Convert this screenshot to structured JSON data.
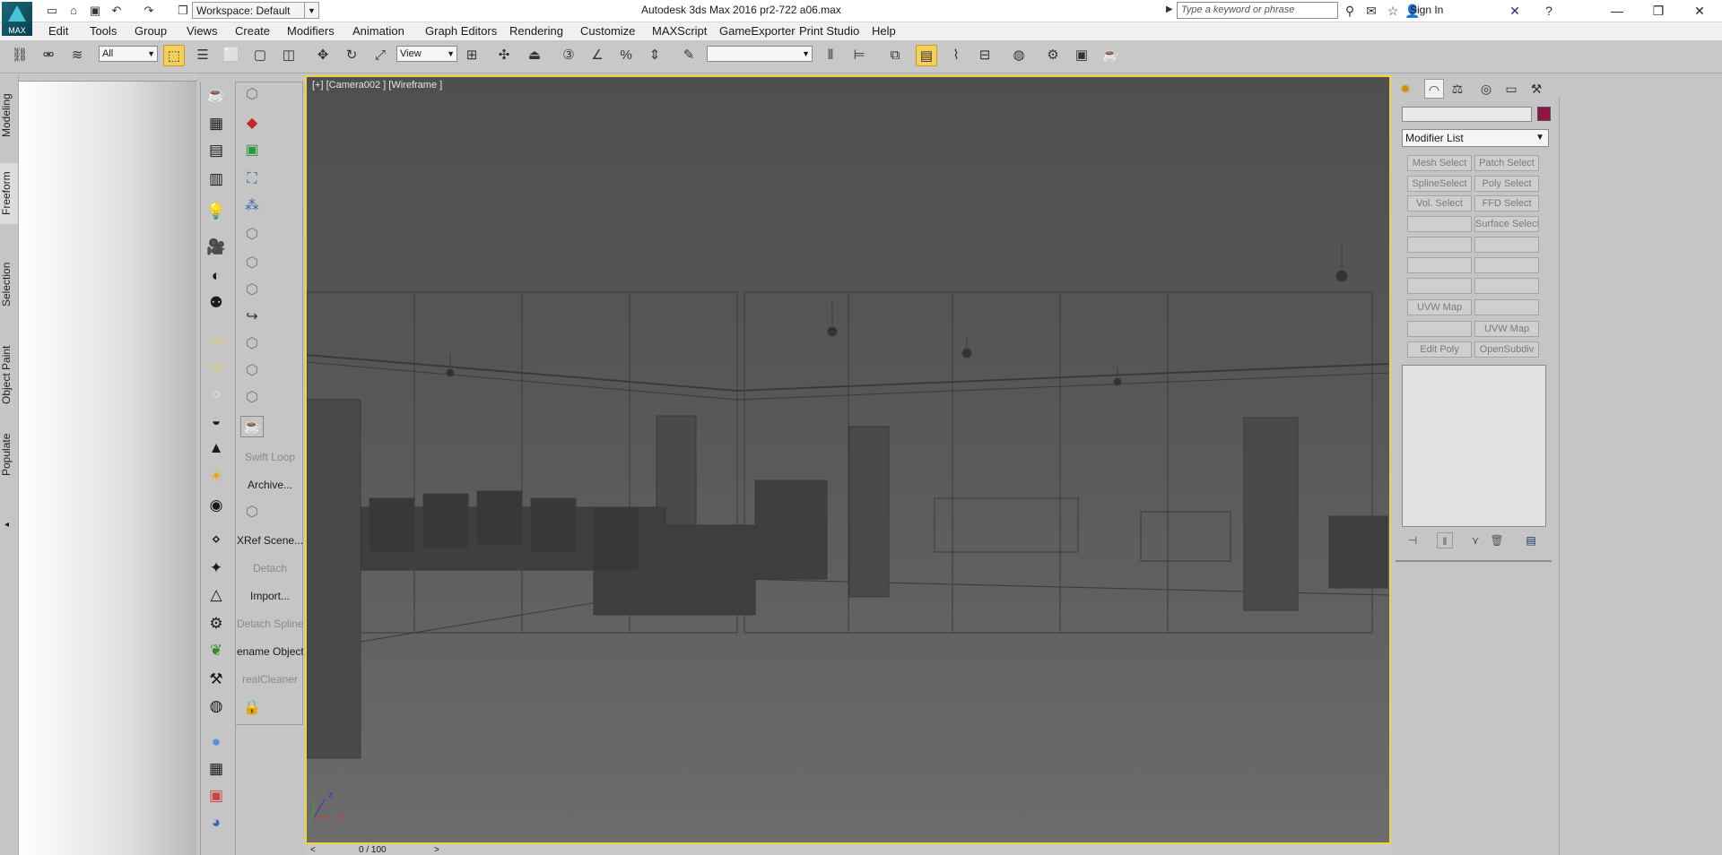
{
  "app": {
    "logo_text": "MAX",
    "window_title": "Autodesk 3ds Max 2016    pr2-722 a06.max",
    "workspace_label": "Workspace: Default",
    "search_placeholder": "Type a keyword or phrase",
    "sign_in": "Sign In"
  },
  "menu": [
    "Edit",
    "Tools",
    "Group",
    "Views",
    "Create",
    "Modifiers",
    "Animation",
    "Graph Editors",
    "Rendering",
    "Customize",
    "MAXScript",
    "GameExporter",
    "Print Studio",
    "Help"
  ],
  "toolbar": {
    "selection_filter": "All",
    "reference_coord": "View",
    "named_selection": ""
  },
  "ribbon_tabs": [
    "Modeling",
    "Freeform",
    "Selection",
    "Object Paint",
    "Populate"
  ],
  "custom_toolbar": {
    "swift_loop": "Swift Loop",
    "archive": "Archive...",
    "xref_scene": "XRef Scene...",
    "detach": "Detach",
    "import": "Import...",
    "detach_spline": "Detach Spline",
    "rename_objects": "ename Objects",
    "real_cleaner": "realCleaner"
  },
  "viewport": {
    "label": "[+] [Camera002 ] [Wireframe ]",
    "axis_x": "x",
    "axis_y": "y",
    "axis_z": "z"
  },
  "timeline": {
    "counter": "0 / 100"
  },
  "command_panel": {
    "object_color": "#8f1544",
    "modifier_list_label": "Modifier List",
    "modifier_buttons": [
      [
        "Mesh Select",
        "Patch Select"
      ],
      [
        "SplineSelect",
        "Poly Select"
      ],
      [
        "Vol. Select",
        "FFD Select"
      ],
      [
        "",
        "Surface Select"
      ],
      [
        "",
        ""
      ],
      [
        "",
        ""
      ],
      [
        "",
        ""
      ],
      [
        "UVW Map",
        ""
      ],
      [
        "",
        "UVW Map"
      ],
      [
        "Edit Poly",
        "OpenSubdiv"
      ]
    ]
  }
}
